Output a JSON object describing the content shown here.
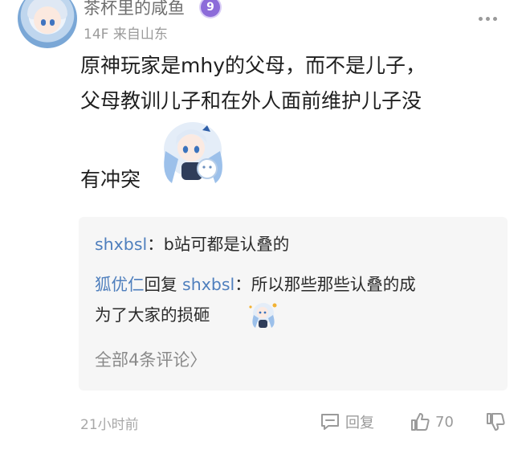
{
  "post": {
    "username": "茶杯里的咸鱼",
    "level": "9",
    "floor": "14F",
    "location": "来自山东",
    "content_lines": [
      "原神玩家是mhy的父母，而不是儿子，",
      "父母教训儿子和在外人面前维护儿子没"
    ],
    "content_tail": "有冲突",
    "timestamp": "21小时前",
    "reply_label": "回复",
    "like_count": "70"
  },
  "replies": [
    {
      "user": "shxbsl",
      "sep": "：",
      "text": "b站可都是认叠的"
    },
    {
      "user": "狐优仁",
      "verb": "回复",
      "target": "shxbsl",
      "sep": "：",
      "text": "所以那些那些认叠的成",
      "text2": "为了大家的损砸"
    }
  ],
  "all_comments": "全部4条评论",
  "all_comments_arrow": "〉",
  "icons": {
    "more": "more-icon",
    "reply": "reply-icon",
    "like": "thumbs-up-icon",
    "dislike": "thumbs-down-icon"
  },
  "colors": {
    "username_link": "#4f7fbd",
    "level_badge": "#8c6bd9",
    "muted": "#9a9a9a"
  }
}
